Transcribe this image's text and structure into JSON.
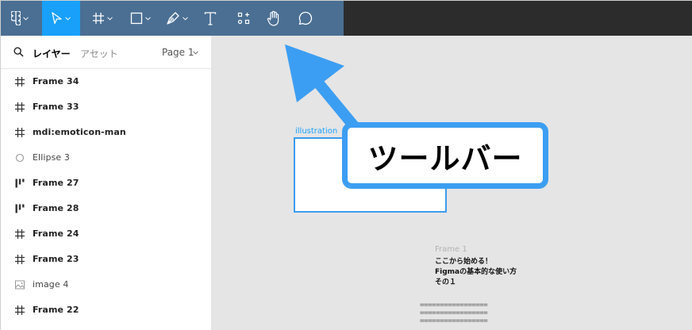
{
  "toolbar": {
    "tools": [
      {
        "name": "figma-menu",
        "icon": "figma-logo-icon"
      },
      {
        "name": "move",
        "icon": "cursor-icon",
        "active": true
      },
      {
        "name": "frame",
        "icon": "frame-icon"
      },
      {
        "name": "shape",
        "icon": "rectangle-icon"
      },
      {
        "name": "pen",
        "icon": "pen-icon"
      },
      {
        "name": "text",
        "icon": "text-icon"
      },
      {
        "name": "resources",
        "icon": "components-icon"
      },
      {
        "name": "hand",
        "icon": "hand-icon"
      },
      {
        "name": "comment",
        "icon": "comment-icon"
      }
    ],
    "colors": {
      "bar": "#2c2c2c",
      "highlight": "#4a6f93",
      "active": "#18a0fb"
    }
  },
  "panel": {
    "tab_layers": "レイヤー",
    "tab_assets": "アセット",
    "page": "Page 1",
    "layers": [
      {
        "label": "Frame 34",
        "icon": "frame-icon"
      },
      {
        "label": "Frame 33",
        "icon": "frame-icon"
      },
      {
        "label": "mdi:emoticon-man",
        "icon": "frame-icon"
      },
      {
        "label": "Ellipse 3",
        "icon": "ellipse-icon"
      },
      {
        "label": "Frame 27",
        "icon": "auto-layout-icon"
      },
      {
        "label": "Frame 28",
        "icon": "auto-layout-icon"
      },
      {
        "label": "Frame 24",
        "icon": "frame-icon"
      },
      {
        "label": "Frame 23",
        "icon": "frame-icon"
      },
      {
        "label": "image 4",
        "icon": "image-icon"
      },
      {
        "label": "Frame 22",
        "icon": "frame-icon"
      }
    ]
  },
  "canvas": {
    "frame_label": "illustration",
    "frame1_label": "Frame 1",
    "frame1_lines": [
      "ここから始める！",
      "Figmaの基本的な使い方",
      "その１"
    ],
    "eq_lines": [
      "=================",
      "=================",
      "================="
    ]
  },
  "annotation": {
    "callout_text": "ツールバー",
    "color": "#3c9ef2"
  }
}
